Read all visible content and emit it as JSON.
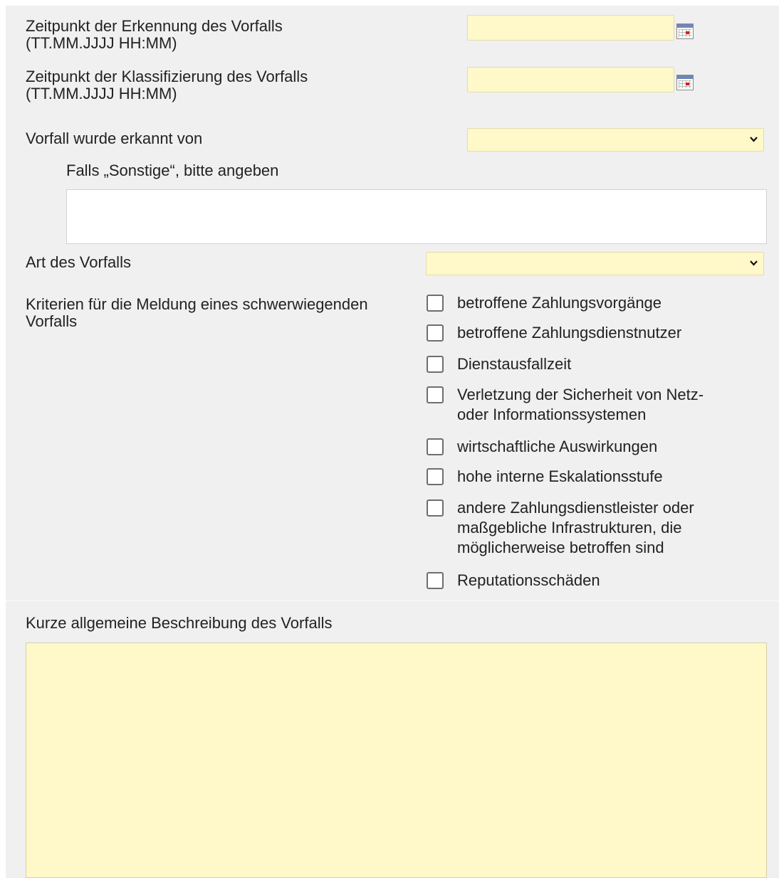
{
  "fields": {
    "detection_time_label_line1": "Zeitpunkt der Erkennung des Vorfalls",
    "detection_time_label_line2": "(TT.MM.JJJJ HH:MM)",
    "detection_time_value": "",
    "classification_time_label_line1": "Zeitpunkt der Klassifizierung des Vorfalls",
    "classification_time_label_line2": "(TT.MM.JJJJ HH:MM)",
    "classification_time_value": "",
    "detected_by_label": "Vorfall wurde erkannt von",
    "detected_by_value": "",
    "other_label": "Falls „Sonstige“, bitte angeben",
    "other_value": "",
    "incident_type_label": "Art des Vorfalls",
    "incident_type_value": "",
    "criteria_label_line1": "Kriterien für die Meldung eines schwerwiegenden",
    "criteria_label_line2": "Vorfalls",
    "description_label": "Kurze allgemeine Beschreibung des Vorfalls",
    "description_value": ""
  },
  "criteria": [
    {
      "label": "betroffene Zahlungsvorgänge",
      "checked": false
    },
    {
      "label": "betroffene Zahlungsdienstnutzer",
      "checked": false
    },
    {
      "label": "Dienstausfallzeit",
      "checked": false
    },
    {
      "label_line1": "Verletzung der Sicherheit von Netz-",
      "label_line2": "oder Informationssystemen",
      "checked": false
    },
    {
      "label": "wirtschaftliche Auswirkungen",
      "checked": false
    },
    {
      "label": "hohe interne Eskalationsstufe",
      "checked": false
    },
    {
      "label_line1": "andere Zahlungsdienstleister oder",
      "label_line2": "maßgebliche Infrastrukturen, die",
      "label_line3": "möglicherweise betroffen sind",
      "checked": false
    },
    {
      "label": "Reputationsschäden",
      "checked": false
    }
  ],
  "icons": {
    "calendar": "calendar-icon",
    "dropdown": "chevron-down-icon"
  },
  "colors": {
    "required_field_bg": "#fff8c8",
    "panel_bg": "#f0f0f0"
  }
}
